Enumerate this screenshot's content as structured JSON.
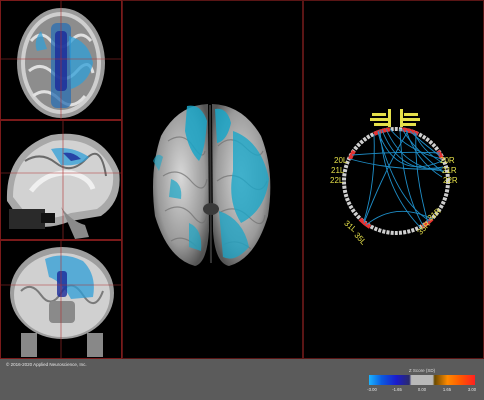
{
  "connectome": {
    "labels_left": [
      "20L",
      "21L",
      "22L"
    ],
    "labels_right": [
      "20R",
      "21R",
      "22R"
    ],
    "labels_lower_left": [
      "31L",
      "35L"
    ],
    "labels_lower_right": [
      "31R",
      "35R"
    ]
  },
  "footer": {
    "copyright": "© 2016-2020 Applied Neuroscience, Inc."
  },
  "scale": {
    "title": "Z Score (SD)",
    "ticks": [
      "-3.00",
      "-1.65",
      "0.00",
      "1.65",
      "3.00"
    ],
    "colors": {
      "neg_high": "#1ab3ff",
      "neg_low": "#1b1bcc",
      "neutral": "#b9b9b9",
      "pos_low": "#ff8a00",
      "pos_high": "#ff2020"
    }
  },
  "colors": {
    "frame_border": "#7a1a1a",
    "activation": "#1aa6c8",
    "label_yellow": "#e5e04a",
    "node_red": "#e63232"
  }
}
